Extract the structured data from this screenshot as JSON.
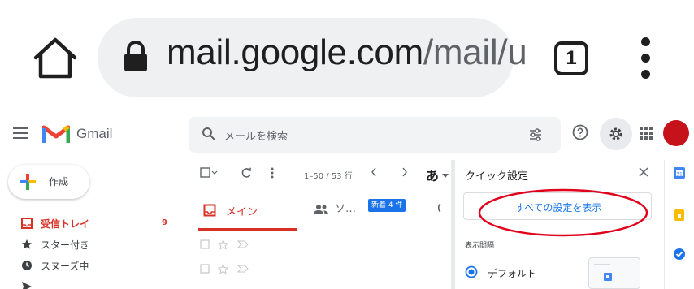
{
  "browser": {
    "url_host": "mail.google.com",
    "url_path": "/mail/u",
    "tab_count": "1"
  },
  "gmail": {
    "app_name": "Gmail",
    "search_placeholder": "メールを検索",
    "compose_label": "作成",
    "nav": [
      {
        "label": "受信トレイ",
        "count": "9",
        "icon": "inbox-icon"
      },
      {
        "label": "スター付き",
        "icon": "star-icon"
      },
      {
        "label": "スヌーズ中",
        "icon": "clock-icon"
      }
    ],
    "toolbar": {
      "range": "1–50 / 53 行",
      "lang": "あ"
    },
    "tabs": {
      "main_label": "メイン",
      "social_label": "ソ…",
      "social_badge": "新着 4 件"
    },
    "quick_settings": {
      "title": "クイック設定",
      "show_all": "すべての設定を表示",
      "density_label": "表示間隔",
      "default_option": "デフォルト"
    }
  },
  "colors": {
    "accent_red": "#d93025",
    "link_blue": "#1a73e8",
    "annotation_red": "#e0001b"
  }
}
